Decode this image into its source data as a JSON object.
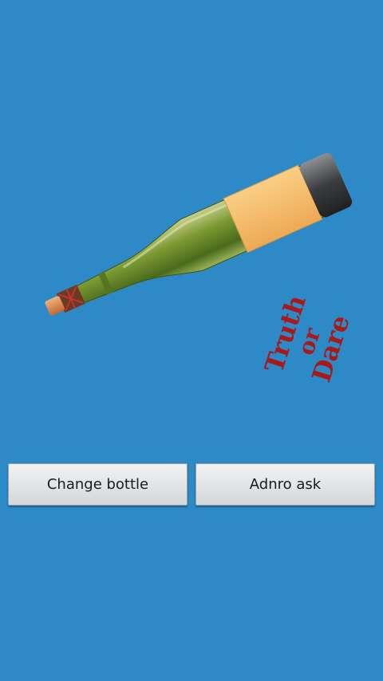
{
  "app": {
    "background_color": "#2e8ac6"
  },
  "bottle": {
    "label_line1": "Truth",
    "label_line2": "or",
    "label_line3": "Dare",
    "label_color": "#a8191b",
    "label_background": "#f3bc6a",
    "glass_color": "#6b8a2a"
  },
  "buttons": {
    "change_bottle_label": "Change bottle",
    "random_ask_label": "Adnro ask"
  }
}
